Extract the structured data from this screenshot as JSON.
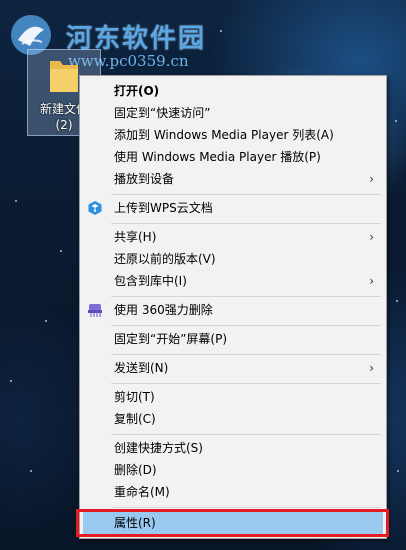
{
  "watermark": {
    "title": "河东软件园",
    "url": "www.pc0359.cn"
  },
  "desktop": {
    "folder_name_line1": "新建文件",
    "folder_name_line2": "(2)"
  },
  "menu": {
    "open": "打开(O)",
    "pin_quick_access": "固定到“快速访问”",
    "add_wmp_list": "添加到 Windows Media Player 列表(A)",
    "play_wmp": "使用 Windows Media Player 播放(P)",
    "cast_to_device": "播放到设备",
    "upload_wps": "上传到WPS云文档",
    "share": "共享(H)",
    "restore_versions": "还原以前的版本(V)",
    "include_library": "包含到库中(I)",
    "delete_360": "使用 360强力删除",
    "pin_start": "固定到“开始”屏幕(P)",
    "send_to": "发送到(N)",
    "cut": "剪切(T)",
    "copy": "复制(C)",
    "create_shortcut": "创建快捷方式(S)",
    "delete": "删除(D)",
    "rename": "重命名(M)",
    "properties": "属性(R)",
    "submenu_arrow": "›"
  },
  "colors": {
    "highlight": "#99c9ef",
    "annotation_box": "#e31b23",
    "wps_icon": "#2f8fe0",
    "icon_360": "#7b6fd6"
  }
}
